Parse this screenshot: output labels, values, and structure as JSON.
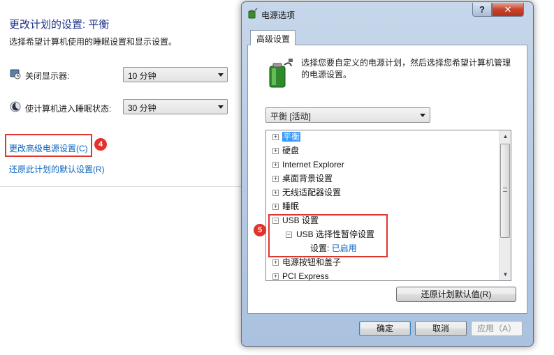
{
  "background": {
    "title": "更改计划的设置: 平衡",
    "subtitle": "选择希望计算机使用的睡眠设置和显示设置。",
    "display_off": {
      "label": "关闭显示器:",
      "value": "10 分钟"
    },
    "sleep": {
      "label": "使计算机进入睡眠状态:",
      "value": "30 分钟"
    },
    "advanced_link": "更改高级电源设置(C)",
    "restore_link": "还原此计划的默认设置(R)",
    "badge_advanced": "4"
  },
  "dialog": {
    "title": "电源选项",
    "help_button": "?",
    "close_button": "✕",
    "tab": "高级设置",
    "description": "选择您要自定义的电源计划，然后选择您希望计算机管理的电源设置。",
    "plan_select": "平衡 [活动]",
    "tree": [
      {
        "label": "平衡",
        "expander": "+"
      },
      {
        "label": "硬盘",
        "expander": "+"
      },
      {
        "label": "Internet Explorer",
        "expander": "+"
      },
      {
        "label": "桌面背景设置",
        "expander": "+"
      },
      {
        "label": "无线适配器设置",
        "expander": "+"
      },
      {
        "label": "睡眠",
        "expander": "+"
      },
      {
        "label": "USB 设置",
        "expander": "−"
      },
      {
        "label": "USB 选择性暂停设置",
        "expander": "−"
      },
      {
        "label": "设置:",
        "value": "已启用"
      },
      {
        "label": "电源按钮和盖子",
        "expander": "+"
      },
      {
        "label": "PCI Express",
        "expander": "+"
      }
    ],
    "badge_usb": "5",
    "restore_defaults_button": "还原计划默认值(R)",
    "ok_button": "确定",
    "cancel_button": "取消",
    "apply_button": "应用（A）"
  },
  "colors": {
    "link": "#0b64c0",
    "highlight_box": "#e0342f",
    "badge": "#e2322c",
    "selection": "#3399ff"
  }
}
